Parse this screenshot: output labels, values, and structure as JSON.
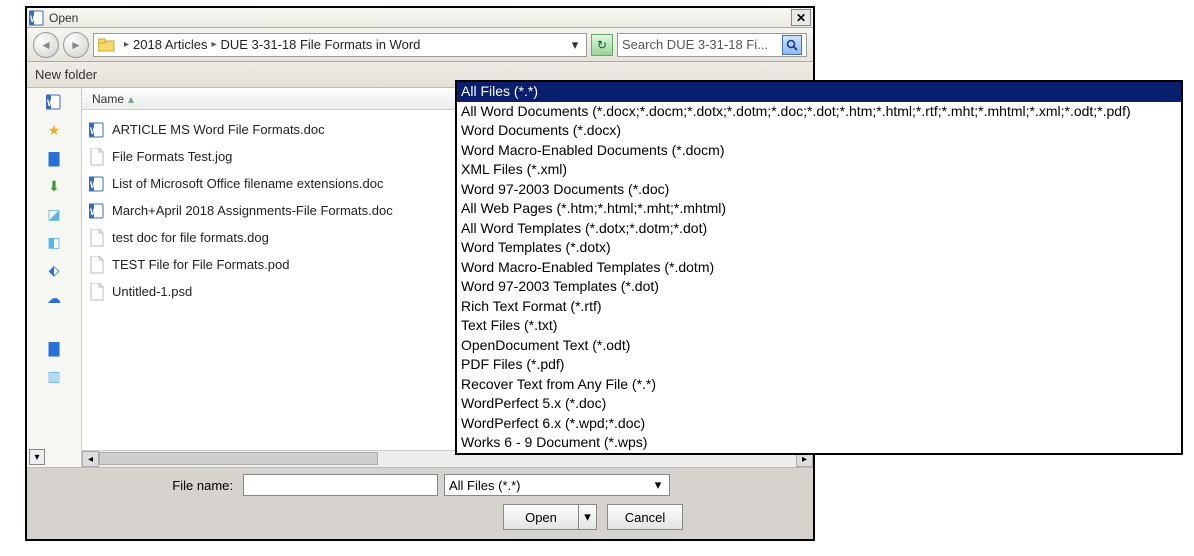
{
  "title": "Open",
  "breadcrumb": {
    "part1": "2018 Articles",
    "part2": "DUE 3-31-18 File Formats in Word"
  },
  "search_placeholder": "Search DUE 3-31-18 Fi...",
  "toolbar": {
    "new_folder": "New folder"
  },
  "column_header": "Name",
  "files": [
    {
      "name": "ARTICLE MS Word File Formats.doc",
      "icon": "word"
    },
    {
      "name": "File Formats Test.jog",
      "icon": "page"
    },
    {
      "name": "List of Microsoft Office filename extensions.doc",
      "icon": "word"
    },
    {
      "name": "March+April 2018 Assignments-File Formats.doc",
      "icon": "word"
    },
    {
      "name": "test doc for file formats.dog",
      "icon": "page"
    },
    {
      "name": "TEST File for File Formats.pod",
      "icon": "page"
    },
    {
      "name": "Untitled-1.psd",
      "icon": "page"
    }
  ],
  "filename_label": "File name:",
  "filetype_selected": "All Files (*.*)",
  "open_label": "Open",
  "cancel_label": "Cancel",
  "filetype_options": [
    "All Files (*.*)",
    "All Word Documents (*.docx;*.docm;*.dotx;*.dotm;*.doc;*.dot;*.htm;*.html;*.rtf;*.mht;*.mhtml;*.xml;*.odt;*.pdf)",
    "Word Documents (*.docx)",
    "Word Macro-Enabled Documents (*.docm)",
    "XML Files (*.xml)",
    "Word 97-2003 Documents (*.doc)",
    "All Web Pages (*.htm;*.html;*.mht;*.mhtml)",
    "All Word Templates (*.dotx;*.dotm;*.dot)",
    "Word Templates (*.dotx)",
    "Word Macro-Enabled Templates (*.dotm)",
    "Word 97-2003 Templates (*.dot)",
    "Rich Text Format (*.rtf)",
    "Text Files (*.txt)",
    "OpenDocument Text (*.odt)",
    "PDF Files (*.pdf)",
    "Recover Text from Any File (*.*)",
    "WordPerfect 5.x (*.doc)",
    "WordPerfect 6.x (*.wpd;*.doc)",
    "Works 6 - 9 Document (*.wps)"
  ],
  "sidebar_icons": [
    "word",
    "star",
    "folder",
    "download",
    "box",
    "box2",
    "dropbox",
    "cloud",
    "gap",
    "folder2",
    "recent"
  ]
}
